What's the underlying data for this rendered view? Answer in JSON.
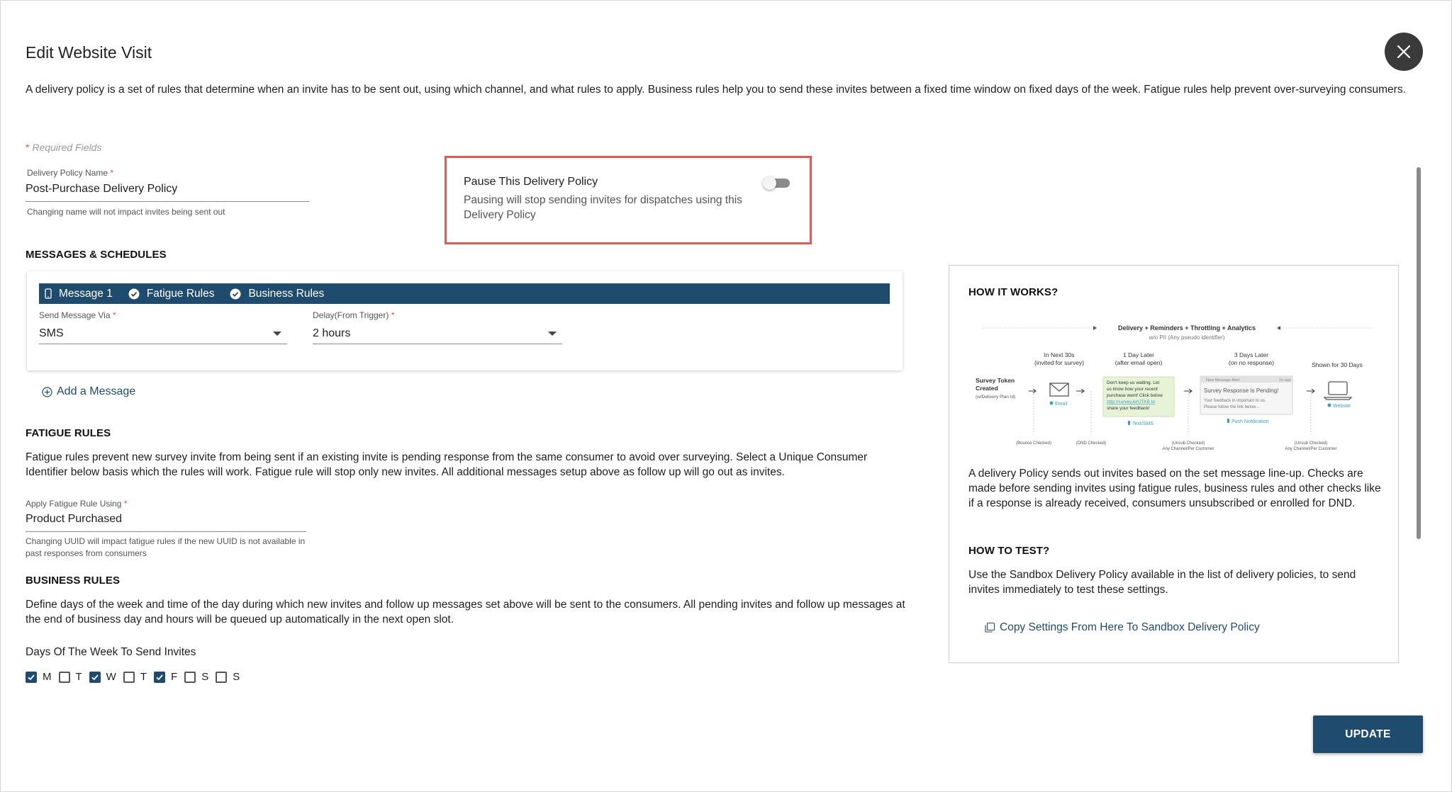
{
  "dialog": {
    "title": "Edit Website Visit",
    "intro": "A delivery policy is a set of rules that determine when an invite has to be sent out, using which channel, and what rules to apply. Business rules help you to send these invites between a fixed time window on fixed days of the week. Fatigue rules help prevent over-surveying consumers.",
    "required_star": "*",
    "required_text": " Required Fields",
    "close_icon": "close-icon"
  },
  "policy_name": {
    "label": "Delivery Policy Name",
    "star": " *",
    "value": "Post-Purchase Delivery Policy",
    "hint": "Changing name will not impact invites being sent out"
  },
  "pause": {
    "title": "Pause This Delivery Policy",
    "description": "Pausing will stop sending invites for dispatches using this Delivery Policy",
    "enabled": false,
    "highlight_color": "#e05a5a"
  },
  "messages": {
    "heading": "MESSAGES & SCHEDULES",
    "tabs": [
      {
        "label": "Message 1",
        "icon": "mobile-icon"
      },
      {
        "label": "Fatigue Rules",
        "icon": "check-circle-icon"
      },
      {
        "label": "Business Rules",
        "icon": "check-circle-icon"
      }
    ],
    "send_via": {
      "label": "Send Message Via",
      "star": " *",
      "value": "SMS"
    },
    "delay": {
      "label": "Delay(From Trigger)",
      "star": " *",
      "value": "2 hours"
    },
    "add_label": "Add a Message"
  },
  "fatigue": {
    "heading": "FATIGUE RULES",
    "description": "Fatigue rules prevent new survey invite from being sent if an existing invite is pending response from the same consumer to avoid over surveying. Select a Unique Consumer Identifier below basis which the rules will work. Fatigue rule will stop only new invites. All additional messages setup above as follow up will go out as invites.",
    "label": "Apply Fatigue Rule Using",
    "star": " *",
    "value": "Product Purchased",
    "hint": "Changing UUID will impact fatigue rules if the new UUID is not available in past responses from consumers"
  },
  "business": {
    "heading": "BUSINESS RULES",
    "description": "Define days of the week and time of the day during which new invites and follow up messages set above will be sent to the consumers. All pending invites and follow up messages at the end of business day and hours will be queued up automatically in the next open slot.",
    "days_label": "Days Of The Week To Send Invites",
    "days": [
      {
        "label": "M",
        "checked": true
      },
      {
        "label": "T",
        "checked": false
      },
      {
        "label": "W",
        "checked": true
      },
      {
        "label": "T",
        "checked": false
      },
      {
        "label": "F",
        "checked": true
      },
      {
        "label": "S",
        "checked": false
      },
      {
        "label": "S",
        "checked": false
      }
    ]
  },
  "how": {
    "heading": "HOW IT WORKS?",
    "diagram": {
      "header": "Delivery + Reminders + Throttling + Analytics",
      "subheader": "w/o PII (Any pseudo identifier)",
      "start_l1": "Survey Token",
      "start_l2": "Created",
      "start_l3": "(w/Delivery Plan Id)",
      "step1_t1": "In Next 30s",
      "step1_t2": "(invited for survey)",
      "step1_label": "Email",
      "step2_t1": "1 Day Later",
      "step2_t2": "(after email open)",
      "step2_msg": [
        "Don't keep us waiting. Let",
        "us know how your recent",
        "purchase went! Click below",
        "http://survey.io/UTKB to",
        "share your feedback!"
      ],
      "step2_label": "Text/SMS",
      "step3_t1": "3 Days Later",
      "step3_t2": "(on no response)",
      "step3_bar": "New Message Alert",
      "step3_time": "1h ago",
      "step3_title": "Survey Response Is Pending!",
      "step3_body": [
        "Your feedback in important to us.",
        "Please follow the link below..."
      ],
      "step3_label": "Push Notification",
      "step4_t1": "Shown for 30 Days",
      "step4_label": "Website",
      "check1": "(Bounce Checked)",
      "check2": "(DND Checked)",
      "check3_l1": "(Unsub Checked)",
      "check3_l2": "Any Channel/Per Customer",
      "check4_l1": "(Unsub Checked)",
      "check4_l2": "Any Channel/Per Customer"
    },
    "description": "A delivery Policy sends out invites based on the set message line-up. Checks are made before sending invites using fatigue rules, business rules and other checks like if a response is already received, consumers unsubscribed or enrolled for DND.",
    "test_heading": "HOW TO TEST?",
    "test_description": "Use the Sandbox Delivery Policy available in the list of delivery policies, to send invites immediately to test these settings.",
    "copy_label": "Copy Settings From Here To Sandbox Delivery Policy"
  },
  "actions": {
    "update_label": "UPDATE"
  },
  "colors": {
    "primary": "#1f4b6e",
    "required": "#d9534f",
    "link_accent": "#3aa0c8",
    "sms_bubble": "#e7f3d6"
  }
}
